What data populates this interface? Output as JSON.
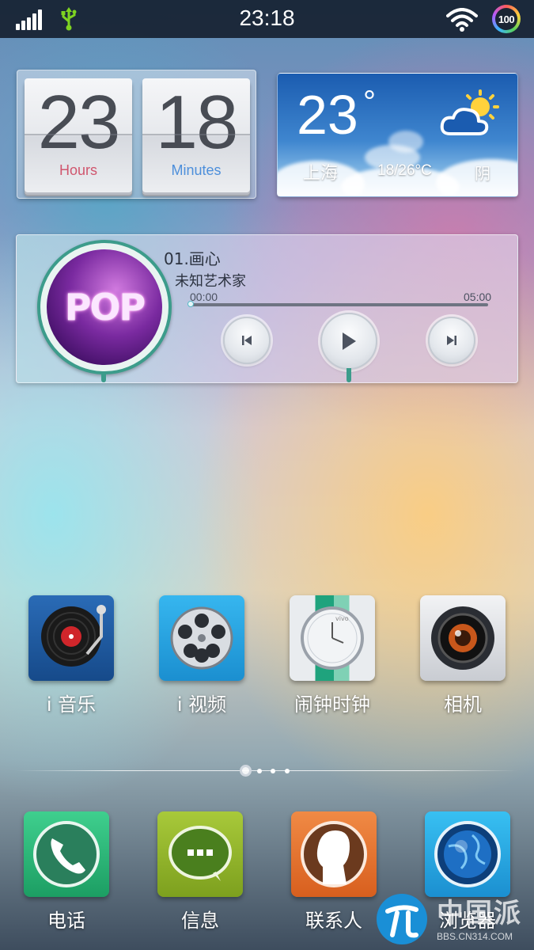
{
  "status_bar": {
    "time": "23:18",
    "battery_level": "100",
    "signal_icon": "cellular-signal-icon",
    "usb_icon": "usb-icon",
    "wifi_icon": "wifi-icon"
  },
  "clock_widget": {
    "hours": "23",
    "hours_label": "Hours",
    "minutes": "18",
    "minutes_label": "Minutes"
  },
  "weather_widget": {
    "temperature": "23",
    "degree_symbol": "°",
    "city": "上海",
    "range": "18/26°C",
    "condition": "阴",
    "icon": "partly-cloudy-icon"
  },
  "music_widget": {
    "album_art_text": "POP",
    "track_title": "01.画心",
    "artist": "未知艺术家",
    "current_time": "00:00",
    "total_time": "05:00",
    "progress_fraction": 0.0
  },
  "apps": [
    {
      "label": "i 音乐",
      "icon": "music-app-icon"
    },
    {
      "label": "i 视频",
      "icon": "video-app-icon"
    },
    {
      "label": "闹钟时钟",
      "icon": "clock-app-icon"
    },
    {
      "label": "相机",
      "icon": "camera-app-icon"
    }
  ],
  "page_indicator": {
    "pages": 4,
    "current": 1
  },
  "dock": [
    {
      "label": "电话",
      "icon": "phone-app-icon"
    },
    {
      "label": "信息",
      "icon": "messages-app-icon"
    },
    {
      "label": "联系人",
      "icon": "contacts-app-icon"
    },
    {
      "label": "浏览器",
      "icon": "browser-app-icon"
    }
  ],
  "watermark": {
    "site_name": "中国派",
    "url": "BBS.CN314.COM",
    "logo": "cn314-logo-icon"
  }
}
